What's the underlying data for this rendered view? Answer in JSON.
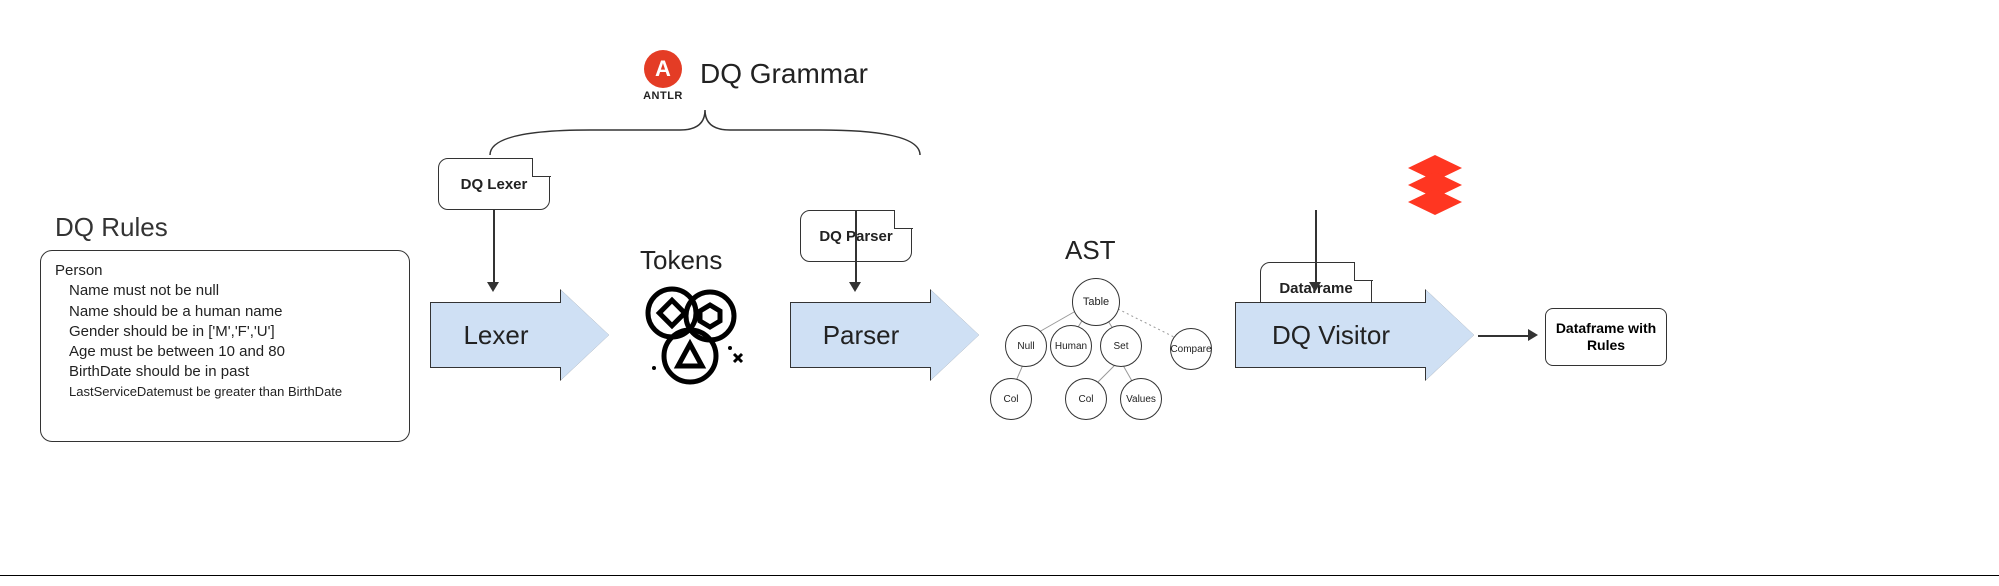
{
  "rules": {
    "title": "DQ Rules",
    "entity": "Person",
    "items": [
      "Name must not be null",
      "Name should be a human name",
      "Gender should be in ['M','F','U']",
      "Age must be between 10 and 80",
      "BirthDate should be in past",
      "LastServiceDatemust be greater than BirthDate"
    ]
  },
  "grammar": {
    "logo_name": "ANTLR",
    "title": "DQ Grammar",
    "lexer_callout": "DQ Lexer",
    "parser_callout": "DQ Parser",
    "dataframe_callout": "Dataframe"
  },
  "stages": {
    "lexer": "Lexer",
    "tokens": "Tokens",
    "parser": "Parser",
    "ast": "AST",
    "visitor": "DQ Visitor",
    "output": "Dataframe with Rules"
  },
  "ast_nodes": {
    "root": "Table",
    "l1": [
      "Null",
      "Human",
      "Set",
      "Compare"
    ],
    "l2": [
      "Col",
      "Col",
      "Values"
    ]
  },
  "icons": {
    "antlr": "antlr-logo",
    "tokens": "tokens-icon",
    "databricks": "databricks-logo"
  }
}
